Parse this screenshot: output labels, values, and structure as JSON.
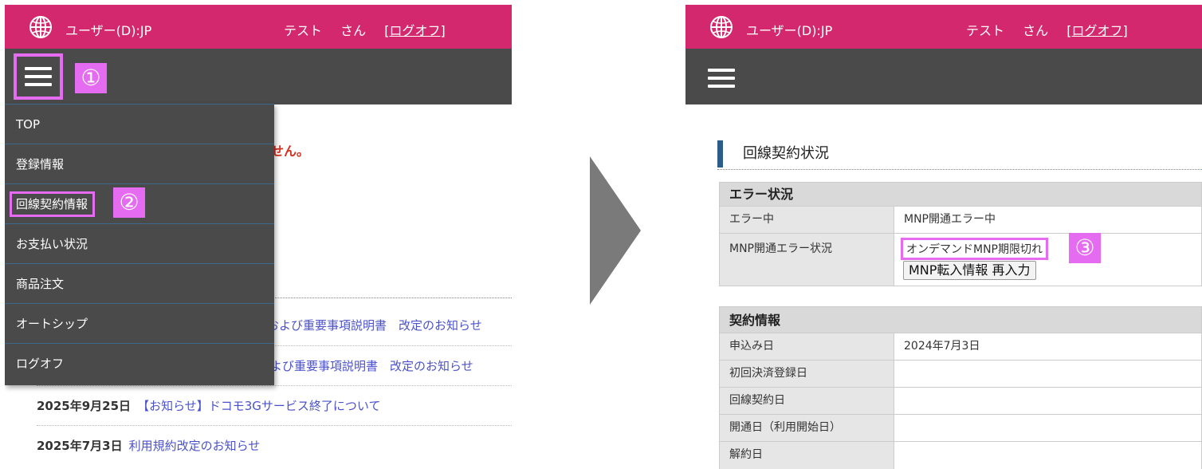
{
  "header": {
    "user_label": "ユーザー(D):JP",
    "user_name": "テスト",
    "honorific": "さん",
    "logoff_open": "[",
    "logoff_label": "ログオフ",
    "logoff_close": "]"
  },
  "steps": {
    "one": "①",
    "two": "②",
    "three": "③"
  },
  "side_menu": {
    "items": [
      {
        "label": "TOP"
      },
      {
        "label": "登録情報"
      },
      {
        "label": "回線契約情報"
      },
      {
        "label": "お支払い状況"
      },
      {
        "label": "商品注文"
      },
      {
        "label": "オートシップ"
      },
      {
        "label": "ログオフ"
      }
    ]
  },
  "left_content": {
    "red_fragment": "せん。",
    "news": [
      {
        "date": "",
        "text": "および重要事項説明書　改定のお知らせ"
      },
      {
        "date": "",
        "text": "よび重要事項説明書　改定のお知らせ"
      },
      {
        "date": "2025年9月25日",
        "text": "【お知らせ】ドコモ3Gサービス終了について"
      },
      {
        "date": "2025年7月3日",
        "text": "利用規約改定のお知らせ"
      }
    ]
  },
  "right_content": {
    "section_title": "回線契約状況",
    "error_table": {
      "heading": "エラー状況",
      "rows": [
        {
          "label": "エラー中",
          "value": "MNP開通エラー中"
        },
        {
          "label": "MNP開通エラー状況",
          "value": "オンデマンドMNP期限切れ",
          "button": "MNP転入情報 再入力"
        }
      ]
    },
    "contract_table": {
      "heading": "契約情報",
      "rows": [
        {
          "label": "申込み日",
          "value": "2024年7月3日"
        },
        {
          "label": "初回決済登録日",
          "value": ""
        },
        {
          "label": "回線契約日",
          "value": ""
        },
        {
          "label": "開通日（利用開始日）",
          "value": ""
        },
        {
          "label": "解約日",
          "value": ""
        }
      ]
    }
  },
  "colors": {
    "header_pink": "#d4286e",
    "nav_gray": "#4a4a4a",
    "highlight_magenta": "#e56bf0",
    "error_red": "#d6301f",
    "link_blue": "#4b52c9",
    "section_blue": "#2b5c8a"
  }
}
